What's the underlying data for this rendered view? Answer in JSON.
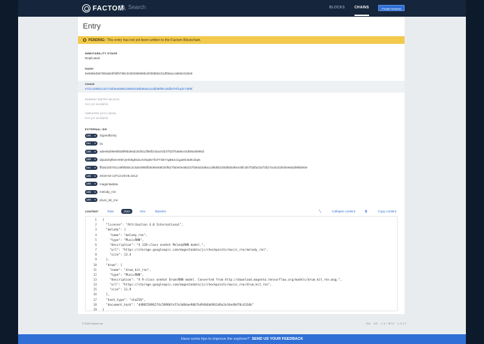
{
  "header": {
    "logo_text": "FACTOM",
    "search_placeholder": "Search",
    "nav": [
      "BLOCKS",
      "CHAINS"
    ],
    "network_button": "Private Network"
  },
  "page": {
    "title": "Entry",
    "pending_label": "PENDING:",
    "pending_text": "This entry has not yet been written to the Factom Blockchain."
  },
  "fields": {
    "immutability_label": "IMMUTABILITY STAGE",
    "immutability_value": "Replicated",
    "hash_label": "HASH",
    "hash_value": "5e58664b678bda63f35fb788c32d0286598b42f39885231df55acca966242de9",
    "chain_label": "CHAIN",
    "chain_value": "e72cc286bc232744b6ae889c25960158b85ae113db98f9cc8db07ef1adc7389f",
    "parent_label": "PARENT ENTRY BLOCK",
    "parent_value": "Not yet available",
    "created_label": "CREATED (UTC-0000)",
    "created_value": "Not yet available",
    "external_ids_label": "EXTERNAL IDS"
  },
  "external_ids": [
    {
      "format": "Utf8",
      "value": "SignedEntry"
    },
    {
      "format": "Hex",
      "value": "01"
    },
    {
      "format": "Utf8",
      "value": "adee6a09e690d8f9bde6d192fa12f68f2c5ac0cb37f2d75a68ce2d09a469662"
    },
    {
      "format": "Utf8",
      "value": "idpub3Qf5mHHEVyHb9gh52uAVbq9s7hsFT3EYrgB8JoCga9iC8dKUbp5"
    },
    {
      "format": "Hex",
      "value": "ffba5150761ca9f8555c2c5de396bfb5069458020f627fa0e0ea65237fa94d4d8accd8d6b235db5bd94e35fcd57f3dfa22d73b27ac5232930e66dd99bb60e"
    },
    {
      "format": "Utf8",
      "value": "2019-03-13T13:29:06.321Z"
    },
    {
      "format": "Utf8",
      "value": "magentadata"
    },
    {
      "format": "Utf8",
      "value": "melody_rnn"
    },
    {
      "format": "Utf8",
      "value": "drum_kit_rnn"
    }
  ],
  "content": {
    "label": "CONTENT",
    "tabs": [
      "Raw",
      "Json",
      "Hex",
      "Base64"
    ],
    "collapse": "Collapse content",
    "copy": "Copy content",
    "lines": [
      "{",
      "  \"license\": \"Attribution 4.0 International\",",
      "  \"melody\": {",
      "    \"name\": \"melody_rnn\",",
      "    \"type\": \"MusicRNN\",",
      "    \"description\": \"A 128-class onehot MelodyRNN model.\",",
      "    \"url\": \"https://storage.googleapis.com/magentadata/js/checkpoints/music_rnn/melody_rnn\",",
      "    \"size\": 13.4",
      "  },",
      "  \"drum\": {",
      "    \"name\": \"drum_kit_rnn\",",
      "    \"type\": \"MusicRNN\",",
      "    \"description\": \"A 9-class onehot DrumsRNN model. Converted from http://download.magenta.tensorflow.org/models/drum_kit_rnn.mag.\",",
      "    \"url\": \"https://storage.googleapis.com/magentadata/js/checkpoints/music_rnn/drum_kit_rnn\",",
      "    \"size\": 11.9",
      "  },",
      "  \"hash_type\": \"sha256\",",
      "  \"document_hash\": \"d48055896274c58986fe57e3d8dae9067b494b6b6961d9a2e34ed9d78c433db\"",
      "}"
    ]
  },
  "footer": {
    "copyright": "© 2019 Factom Inc.",
    "right": "EN · US · 1.0 / BTC · 1.0.17"
  },
  "banner": {
    "text": "Have some tips to improve the explorer?",
    "link": "SEND US YOUR FEEDBACK"
  }
}
